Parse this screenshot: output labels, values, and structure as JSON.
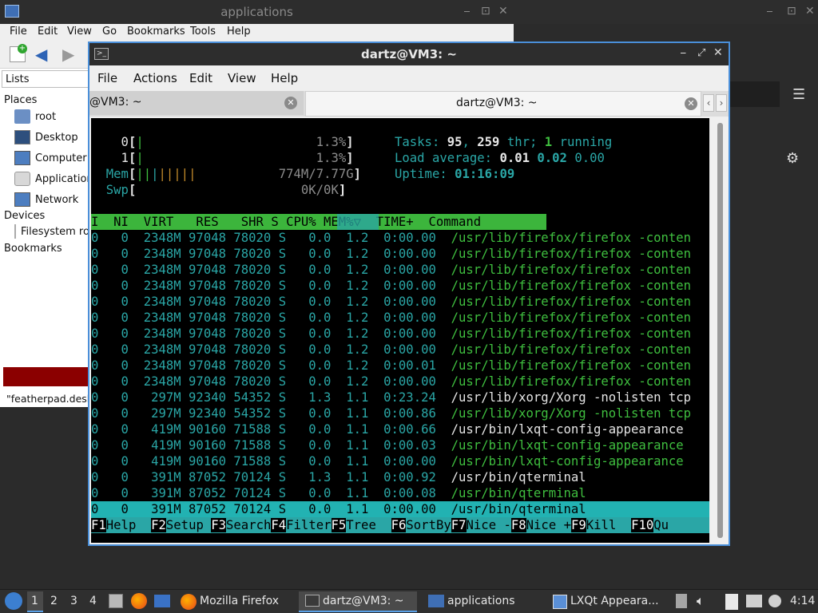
{
  "desktop": {
    "title": "applications",
    "minimize": "⎯",
    "close": "✕",
    "restore": "⊡"
  },
  "filemanager": {
    "menu": [
      "File",
      "Edit",
      "View",
      "Go",
      "Bookmarks",
      "Tools",
      "Help"
    ],
    "lists_label": "Lists",
    "places_label": "Places",
    "places": [
      "root",
      "Desktop",
      "Computer",
      "Applications",
      "Network"
    ],
    "devices_label": "Devices",
    "devices": [
      "Filesystem root"
    ],
    "bookmarks_label": "Bookmarks",
    "status": "\"featherpad.desktop\""
  },
  "terminal": {
    "title": "dartz@VM3: ~",
    "menu": [
      "File",
      "Actions",
      "Edit",
      "View",
      "Help"
    ],
    "tabs": [
      {
        "label": "@VM3: ~"
      },
      {
        "label": "dartz@VM3: ~"
      }
    ],
    "htop": {
      "cpu0": "1.3%",
      "cpu1": "1.3%",
      "mem": "774M/7.77G",
      "swp": "0K/0K",
      "tasks": "95",
      "threads": "259",
      "running": "1",
      "load1": "0.01",
      "load5": "0.02",
      "load15": "0.00",
      "uptime": "01:16:09",
      "header": "I  NI  VIRT   RES   SHR S CPU% MEM%▽  TIME+  Command",
      "rows": [
        [
          "0",
          "0",
          "2348M",
          "97048",
          "78020",
          "S",
          "0.0",
          "1.2",
          "0:00.00",
          "/usr/lib/firefox/firefox -conten"
        ],
        [
          "0",
          "0",
          "2348M",
          "97048",
          "78020",
          "S",
          "0.0",
          "1.2",
          "0:00.00",
          "/usr/lib/firefox/firefox -conten"
        ],
        [
          "0",
          "0",
          "2348M",
          "97048",
          "78020",
          "S",
          "0.0",
          "1.2",
          "0:00.00",
          "/usr/lib/firefox/firefox -conten"
        ],
        [
          "0",
          "0",
          "2348M",
          "97048",
          "78020",
          "S",
          "0.0",
          "1.2",
          "0:00.00",
          "/usr/lib/firefox/firefox -conten"
        ],
        [
          "0",
          "0",
          "2348M",
          "97048",
          "78020",
          "S",
          "0.0",
          "1.2",
          "0:00.00",
          "/usr/lib/firefox/firefox -conten"
        ],
        [
          "0",
          "0",
          "2348M",
          "97048",
          "78020",
          "S",
          "0.0",
          "1.2",
          "0:00.00",
          "/usr/lib/firefox/firefox -conten"
        ],
        [
          "0",
          "0",
          "2348M",
          "97048",
          "78020",
          "S",
          "0.0",
          "1.2",
          "0:00.00",
          "/usr/lib/firefox/firefox -conten"
        ],
        [
          "0",
          "0",
          "2348M",
          "97048",
          "78020",
          "S",
          "0.0",
          "1.2",
          "0:00.00",
          "/usr/lib/firefox/firefox -conten"
        ],
        [
          "0",
          "0",
          "2348M",
          "97048",
          "78020",
          "S",
          "0.0",
          "1.2",
          "0:00.01",
          "/usr/lib/firefox/firefox -conten"
        ],
        [
          "0",
          "0",
          "2348M",
          "97048",
          "78020",
          "S",
          "0.0",
          "1.2",
          "0:00.00",
          "/usr/lib/firefox/firefox -conten"
        ],
        [
          "0",
          "0",
          "297M",
          "92340",
          "54352",
          "S",
          "1.3",
          "1.1",
          "0:23.24",
          "/usr/lib/xorg/Xorg -nolisten tcp"
        ],
        [
          "0",
          "0",
          "297M",
          "92340",
          "54352",
          "S",
          "0.0",
          "1.1",
          "0:00.86",
          "/usr/lib/xorg/Xorg -nolisten tcp"
        ],
        [
          "0",
          "0",
          "419M",
          "90160",
          "71588",
          "S",
          "0.0",
          "1.1",
          "0:00.66",
          "/usr/bin/lxqt-config-appearance"
        ],
        [
          "0",
          "0",
          "419M",
          "90160",
          "71588",
          "S",
          "0.0",
          "1.1",
          "0:00.03",
          "/usr/bin/lxqt-config-appearance"
        ],
        [
          "0",
          "0",
          "419M",
          "90160",
          "71588",
          "S",
          "0.0",
          "1.1",
          "0:00.00",
          "/usr/bin/lxqt-config-appearance"
        ],
        [
          "0",
          "0",
          "391M",
          "87052",
          "70124",
          "S",
          "1.3",
          "1.1",
          "0:00.92",
          "/usr/bin/qterminal"
        ],
        [
          "0",
          "0",
          "391M",
          "87052",
          "70124",
          "S",
          "0.0",
          "1.1",
          "0:00.08",
          "/usr/bin/qterminal"
        ],
        [
          "0",
          "0",
          "391M",
          "87052",
          "70124",
          "S",
          "0.0",
          "1.1",
          "0:00.00",
          "/usr/bin/qterminal"
        ]
      ],
      "fkeys": [
        [
          "F1",
          "Help  "
        ],
        [
          "F2",
          "Setup "
        ],
        [
          "F3",
          "Search"
        ],
        [
          "F4",
          "Filter"
        ],
        [
          "F5",
          "Tree  "
        ],
        [
          "F6",
          "SortBy"
        ],
        [
          "F7",
          "Nice -"
        ],
        [
          "F8",
          "Nice +"
        ],
        [
          "F9",
          "Kill  "
        ],
        [
          "F10",
          "Qu"
        ]
      ]
    }
  },
  "taskbar": {
    "desktops": [
      "1",
      "2",
      "3",
      "4"
    ],
    "firefox": "Mozilla Firefox",
    "terminal": "dartz@VM3: ~",
    "files": "applications",
    "appearance": "LXQt Appeara...",
    "clock": "4:14"
  },
  "colors": {
    "accent": "#4a8fd9",
    "htop_green": "#3fbf3f",
    "htop_cyan": "#2aa6a6",
    "red_bar": "#8b0000"
  }
}
